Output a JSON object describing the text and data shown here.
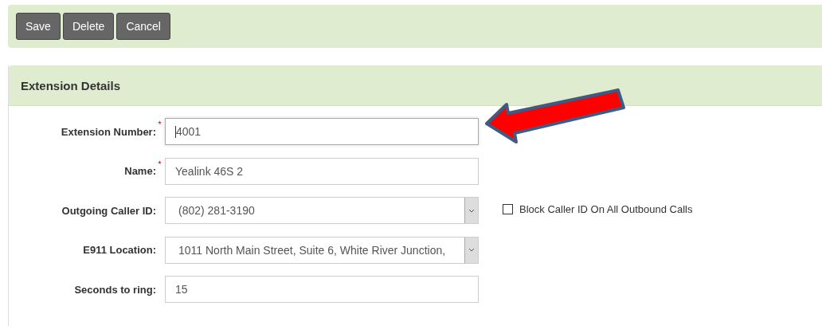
{
  "toolbar": {
    "buttons": [
      "Save",
      "Delete",
      "Cancel"
    ]
  },
  "panel": {
    "title": "Extension Details",
    "fields": [
      {
        "kind": "text",
        "label": "Extension Number:",
        "required": true,
        "value": "4001",
        "focused": true
      },
      {
        "kind": "text",
        "label": "Name:",
        "required": true,
        "value": "Yealink 46S 2",
        "focused": false
      },
      {
        "kind": "select",
        "label": "Outgoing Caller ID:",
        "required": false,
        "value": "(802) 281-3190",
        "option": {
          "label": "Block Caller ID On All Outbound Calls",
          "checked": false
        }
      },
      {
        "kind": "select",
        "label": "E911 Location:",
        "required": false,
        "value": "1011 North Main Street, Suite 6, White River Junction,"
      },
      {
        "kind": "text",
        "label": "Seconds to ring:",
        "required": false,
        "value": "15",
        "focused": false
      }
    ]
  }
}
